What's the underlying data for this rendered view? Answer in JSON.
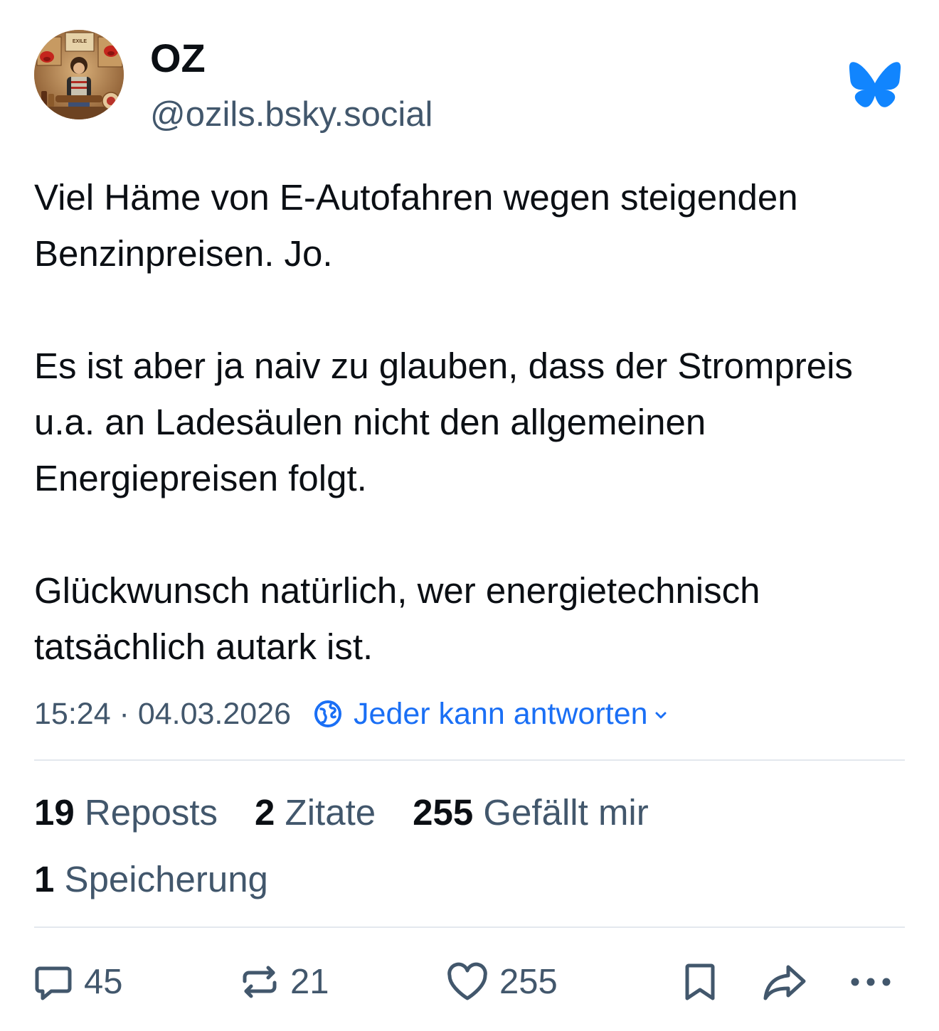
{
  "author": {
    "display_name": "OZ",
    "handle": "@ozils.bsky.social",
    "avatar_text": {
      "top_left": "STUTTGART",
      "top_sign": "EXILE",
      "right_text": "STUTTGART",
      "lower_right": "THE ROLLING STONES"
    }
  },
  "post": {
    "paragraphs": [
      "Viel Häme von E-Autofahren wegen steigenden Benzinpreisen. Jo.",
      "Es ist aber ja naiv zu glauben, dass der Strompreis u.a. an Ladesäulen nicht den allgemeinen Energiepreisen folgt.",
      "Glückwunsch natürlich, wer energietechnisch tatsächlich autark ist."
    ],
    "timestamp": "15:24 · 04.03.2026",
    "reply_setting": "Jeder kann antworten"
  },
  "stats": {
    "reposts": {
      "count": "19",
      "label": "Reposts"
    },
    "quotes": {
      "count": "2",
      "label": "Zitate"
    },
    "likes": {
      "count": "255",
      "label": "Gefällt mir"
    },
    "saves": {
      "count": "1",
      "label": "Speicherung"
    }
  },
  "actions": {
    "reply_count": "45",
    "repost_count": "21",
    "like_count": "255"
  },
  "icons": [
    "bluesky-butterfly-icon",
    "globe-icon",
    "chevron-down-icon",
    "reply-icon",
    "repost-icon",
    "heart-icon",
    "bookmark-icon",
    "share-icon",
    "more-icon"
  ],
  "colors": {
    "text": "#0b0f14",
    "secondary": "#42576c",
    "accent": "#1a6ff5",
    "butterfly": "#1185fe",
    "divider": "#e3e8ee"
  }
}
